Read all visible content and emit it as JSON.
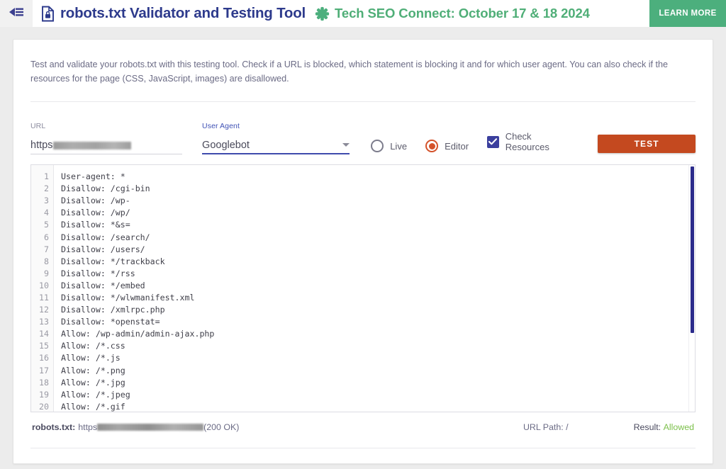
{
  "topbar": {
    "menu_icon": "collapse-menu-icon",
    "doc_icon": "document-lock-icon",
    "title": "robots.txt Validator and Testing Tool",
    "promo_icon": "asterisk-flower-icon",
    "promo_text": "Tech SEO Connect: October 17 & 18 2024",
    "learn_more_label": "LEARN MORE",
    "title_color": "#2d3a8c",
    "promo_color": "#4fae77",
    "learn_more_bg": "#4caf7d"
  },
  "intro": "Test and validate your robots.txt with this testing tool. Check if a URL is blocked, which statement is blocking it and for which user agent. You can also check if the resources for the page (CSS, JavaScript, images) are disallowed.",
  "form": {
    "url": {
      "label": "URL",
      "value_prefix": "https",
      "value_redacted": true,
      "placeholder": "URL"
    },
    "user_agent": {
      "label": "User Agent",
      "value": "Googlebot",
      "options": [
        "Googlebot"
      ],
      "focused": true,
      "caret_icon": "chevron-down-icon"
    },
    "source_mode": {
      "options": [
        {
          "label": "Live",
          "selected": false
        },
        {
          "label": "Editor",
          "selected": true
        }
      ],
      "selected_color": "#d4522a"
    },
    "check_resources": {
      "label": "Check Resources",
      "checked": true,
      "check_icon": "checkmark-icon",
      "color": "#3b3f9e"
    },
    "test_button": {
      "label": "TEST",
      "color": "#c4491f"
    }
  },
  "editor": {
    "line_numbers": [
      "1",
      "2",
      "3",
      "4",
      "5",
      "6",
      "7",
      "8",
      "9",
      "10",
      "11",
      "12",
      "13",
      "14",
      "15",
      "16",
      "17",
      "18",
      "19",
      "20"
    ],
    "lines": [
      "User-agent: *",
      "Disallow: /cgi-bin",
      "Disallow: /wp-",
      "Disallow: /wp/",
      "Disallow: *&s=",
      "Disallow: /search/",
      "Disallow: /users/",
      "Disallow: */trackback",
      "Disallow: */rss",
      "Disallow: */embed",
      "Disallow: */wlwmanifest.xml",
      "Disallow: /xmlrpc.php",
      "Disallow: *openstat=",
      "Allow: /wp-admin/admin-ajax.php",
      "Allow: /*.css",
      "Allow: /*.js",
      "Allow: /*.png",
      "Allow: /*.jpg",
      "Allow: /*.jpeg",
      "Allow: /*.gif"
    ],
    "scrollbar_color": "#2b2b8c"
  },
  "status": {
    "robots_label": "robots.txt:",
    "robots_url_prefix": "https",
    "robots_url_redacted": true,
    "http_status": "(200 OK)",
    "url_path_label": "URL Path:",
    "url_path_value": "/",
    "result_label": "Result:",
    "result_value": "Allowed",
    "result_color": "#7cc04b"
  }
}
